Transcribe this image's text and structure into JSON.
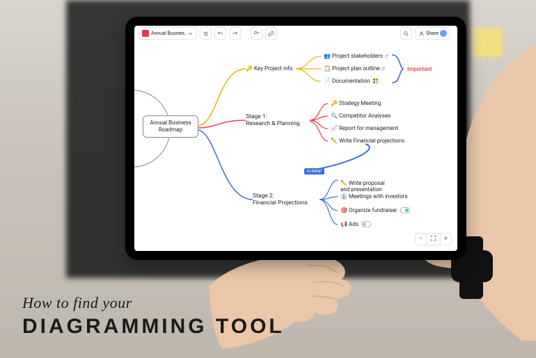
{
  "caption": {
    "line1": "How to find your",
    "line2": "DIAGRAMMING TOOL"
  },
  "toolbar": {
    "doc_title": "Annual Busines..",
    "share_label": "Share"
  },
  "mindmap": {
    "root": "Annual Business\nRoadmap",
    "branches": [
      {
        "id": "key-info",
        "emoji": "🔑",
        "label": "Key Project info",
        "color": "#f0b400",
        "children": [
          {
            "emoji": "👥",
            "label": "Project stakeholders",
            "link": true
          },
          {
            "emoji": "📋",
            "label": "Project plan outline",
            "link": true
          },
          {
            "emoji": "📄",
            "label": "Documentation",
            "icon": "ms"
          }
        ],
        "annotation": "Important"
      },
      {
        "id": "stage1",
        "label": "Stage 1:\nResearch & Planning",
        "color": "#e8384f",
        "children": [
          {
            "emoji": "🔑",
            "label": "Strategy Meeting"
          },
          {
            "emoji": "🔍",
            "label": "Competitor Analyses"
          },
          {
            "emoji": "📈",
            "label": "Report for management"
          },
          {
            "emoji": "✏️",
            "label": "Write Financial projections"
          }
        ]
      },
      {
        "id": "stage2",
        "label": "Stage 2:\nFinancial Projections",
        "color": "#3b6fd6",
        "badge": "in detail",
        "children": [
          {
            "emoji": "✏️",
            "label": "Write proposal\nand presentation"
          },
          {
            "emoji": "👔",
            "label": "Meetings with investors"
          },
          {
            "emoji": "🎯",
            "label": "Organize fundraiser"
          },
          {
            "emoji": "📢",
            "label": "Ads"
          }
        ]
      }
    ]
  },
  "colors": {
    "yellow": "#f0b400",
    "red": "#e8384f",
    "blue": "#3b6fd6"
  }
}
